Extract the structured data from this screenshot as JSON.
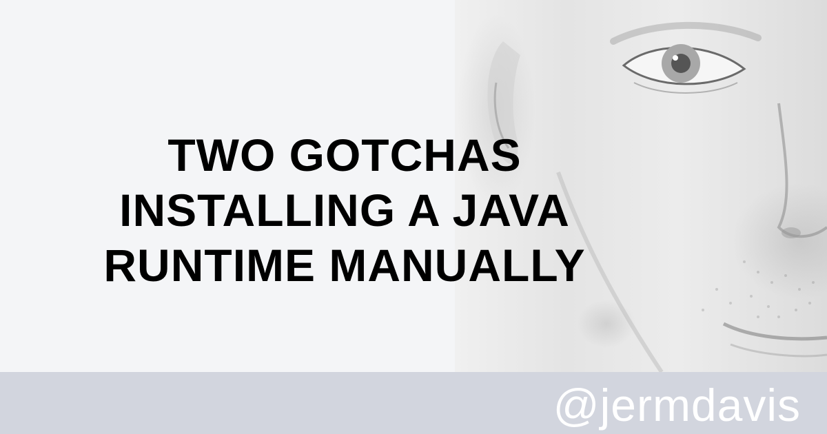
{
  "headline": {
    "lines": [
      "TWO GOTCHAS",
      "INSTALLING A JAVA",
      "RUNTIME MANUALLY"
    ]
  },
  "footer": {
    "handle": "@jermdavis"
  },
  "colors": {
    "background": "#f4f5f7",
    "footer_bar": "#d2d5de",
    "headline_text": "#000000",
    "handle_text": "#ffffff"
  }
}
